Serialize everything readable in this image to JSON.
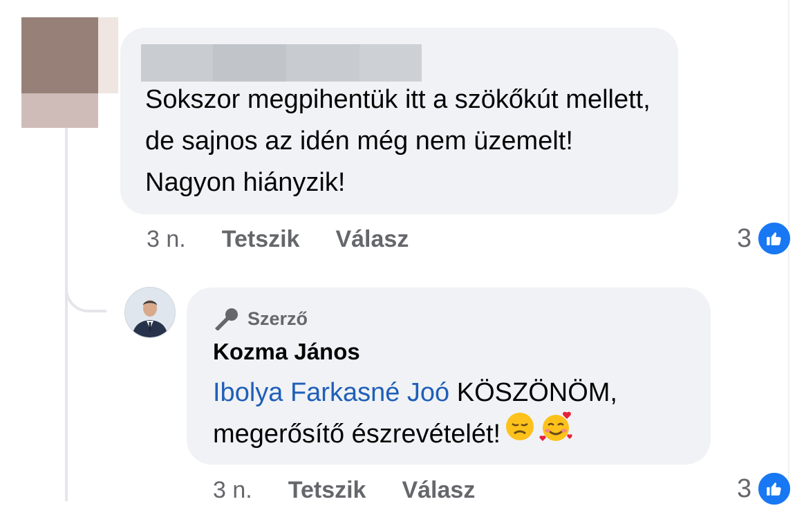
{
  "comments": [
    {
      "author_redacted": true,
      "text": "Sokszor megpihentük itt a szökőkút mellett, de sajnos az idén még nem üzemelt! Nagyon hiányzik!",
      "time": "3 n.",
      "like_label": "Tetszik",
      "reply_label": "Válasz",
      "reaction_count": "3",
      "reaction_icon": "thumbs-up-icon"
    }
  ],
  "reply": {
    "badge_icon": "microphone-icon",
    "badge_label": "Szerző",
    "author": "Kozma János",
    "mention": "Ibolya Farkasné Joó",
    "text": "KÖSZÖNÖM, megerősítő észrevételét!",
    "emojis": [
      "disappointed-face-emoji",
      "smiling-face-with-hearts-emoji"
    ],
    "time": "3 n.",
    "like_label": "Tetszik",
    "reply_label": "Válasz",
    "reaction_count": "3",
    "reaction_icon": "thumbs-up-icon"
  },
  "colors": {
    "bubble": "#f0f2f5",
    "mention": "#1f5fb8",
    "meta": "#65676b",
    "like": "#1877f2"
  }
}
